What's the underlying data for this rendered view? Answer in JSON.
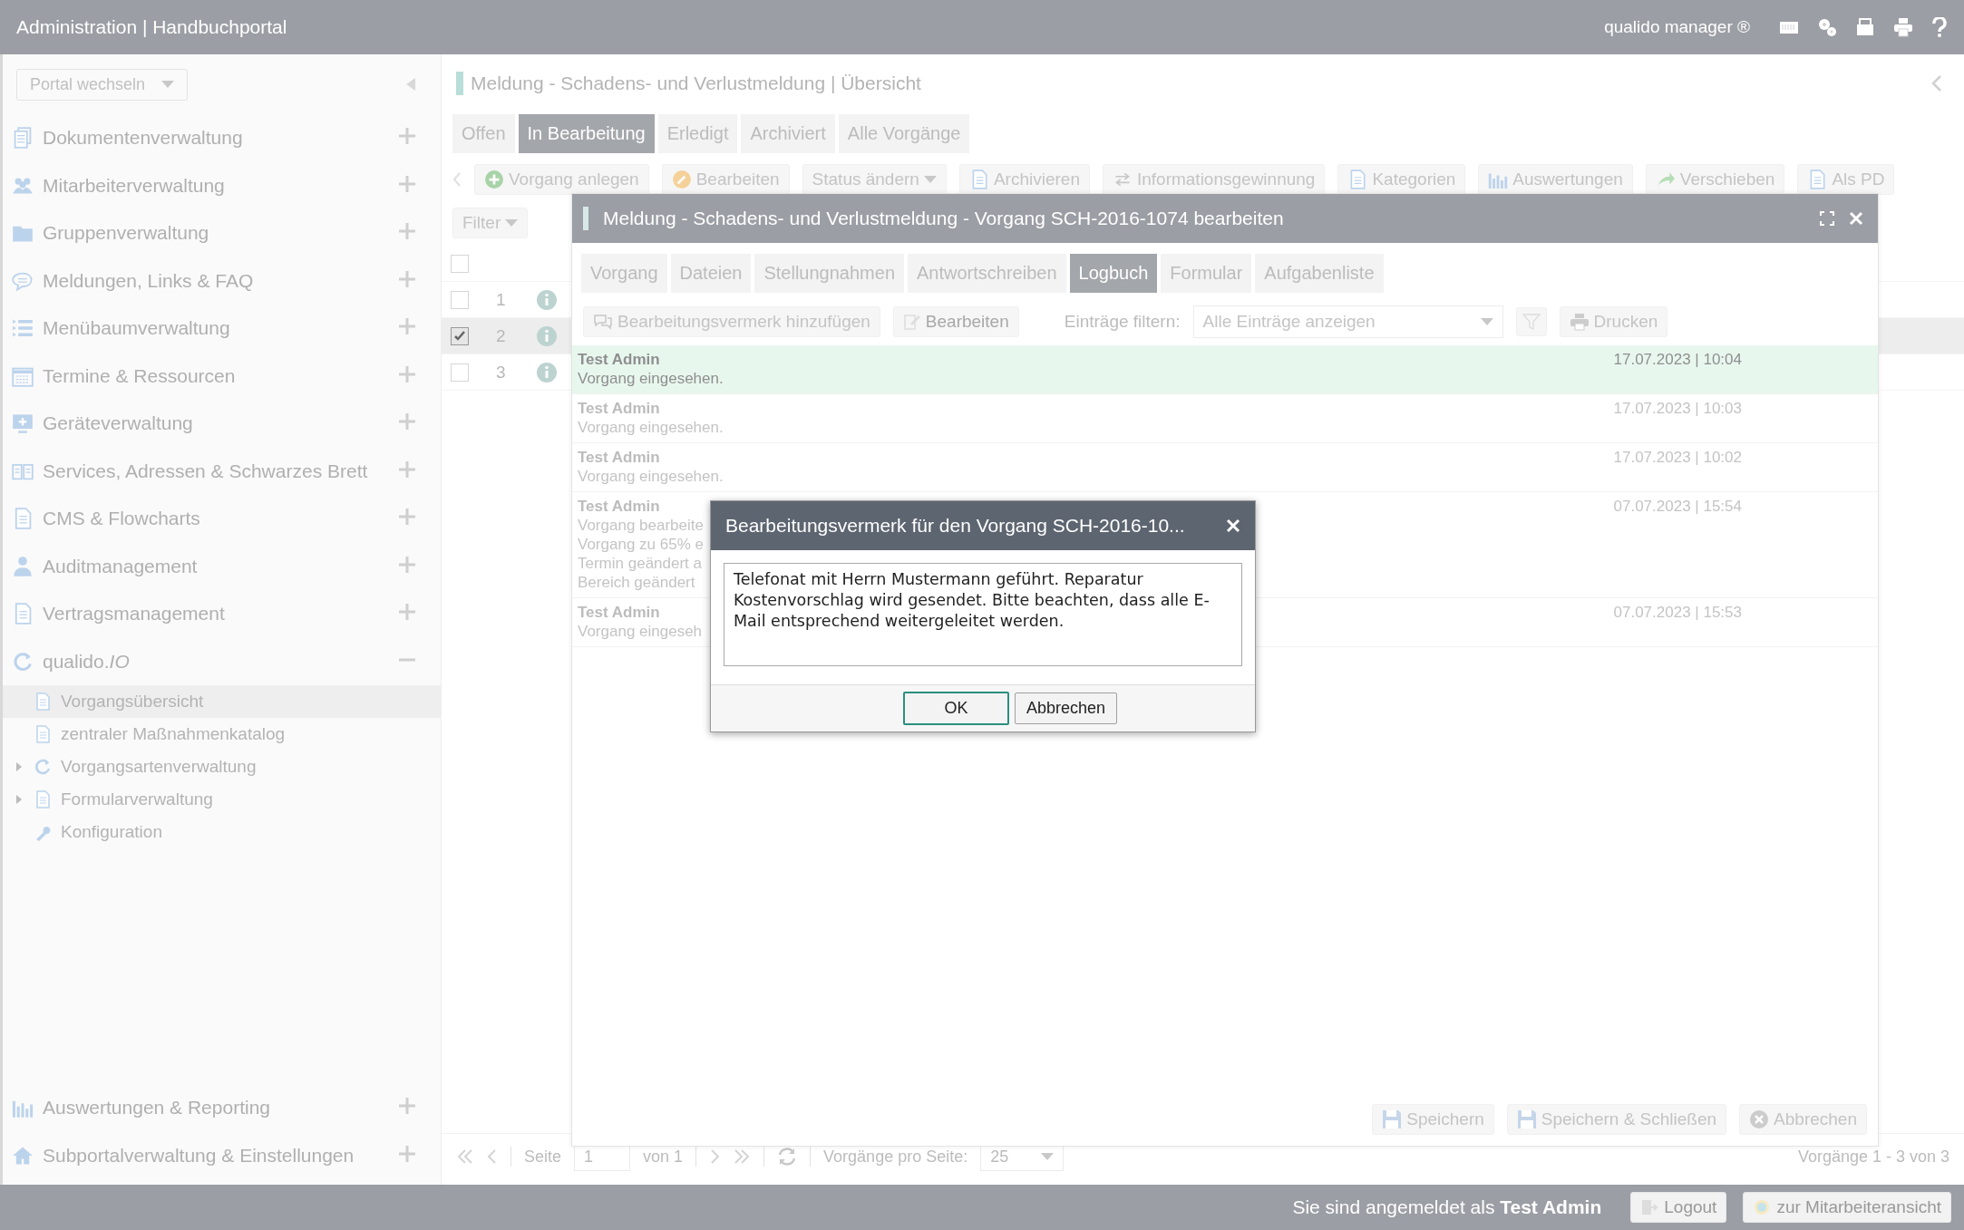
{
  "header": {
    "title": "Administration | Handbuchportal",
    "product": "qualido manager ®"
  },
  "sidebar": {
    "portal_select": "Portal wechseln",
    "items": [
      {
        "label": "Dokumentenverwaltung",
        "expanded": false
      },
      {
        "label": "Mitarbeiterverwaltung",
        "expanded": false
      },
      {
        "label": "Gruppenverwaltung",
        "expanded": false
      },
      {
        "label": "Meldungen, Links & FAQ",
        "expanded": false
      },
      {
        "label": "Menübaumverwaltung",
        "expanded": false
      },
      {
        "label": "Termine & Ressourcen",
        "expanded": false
      },
      {
        "label": "Geräteverwaltung",
        "expanded": false
      },
      {
        "label": "Services, Adressen & Schwarzes Brett",
        "expanded": false
      },
      {
        "label": "CMS & Flowcharts",
        "expanded": false
      },
      {
        "label": "Auditmanagement",
        "expanded": false
      },
      {
        "label": "Vertragsmanagement",
        "expanded": false
      },
      {
        "label": "qualido.*IO*",
        "expanded": true,
        "children": [
          {
            "label": "Vorgangsübersicht",
            "selected": true
          },
          {
            "label": "zentraler Maßnahmenkatalog",
            "selected": false
          },
          {
            "label": "Vorgangsartenverwaltung",
            "selected": false,
            "expanded": false
          },
          {
            "label": "Formularverwaltung",
            "selected": false,
            "expanded": false
          },
          {
            "label": "Konfiguration",
            "selected": false
          }
        ]
      }
    ],
    "bottom_items": [
      {
        "label": "Auswertungen & Reporting",
        "expanded": false
      },
      {
        "label": "Subportalverwaltung & Einstellungen",
        "expanded": false
      }
    ]
  },
  "main": {
    "title": "Meldung - Schadens- und Verlustmeldung | Übersicht",
    "tabs": [
      {
        "label": "Offen",
        "selected": false
      },
      {
        "label": "In Bearbeitung",
        "selected": true
      },
      {
        "label": "Erledigt",
        "selected": false
      },
      {
        "label": "Archiviert",
        "selected": false
      },
      {
        "label": "Alle Vorgänge",
        "selected": false
      }
    ],
    "toolbar": [
      {
        "label": "Vorgang anlegen",
        "kind": "button"
      },
      {
        "label": "Bearbeiten",
        "kind": "button"
      },
      {
        "label": "Status ändern",
        "kind": "dropdown"
      },
      {
        "label": "Archivieren",
        "kind": "button"
      },
      {
        "label": "Informationsgewinnung",
        "kind": "button"
      },
      {
        "label": "Kategorien",
        "kind": "button"
      },
      {
        "label": "Auswertungen",
        "kind": "button"
      },
      {
        "label": "Verschieben",
        "kind": "button"
      },
      {
        "label": "Als PD",
        "kind": "button"
      }
    ],
    "filter": "Filter",
    "header_checked": false,
    "rows": [
      {
        "number": "1",
        "checked": false,
        "selected": false
      },
      {
        "number": "2",
        "checked": true,
        "selected": true
      },
      {
        "number": "3",
        "checked": false,
        "selected": false
      }
    ],
    "pagination": {
      "page_label": "Seite",
      "page": "1",
      "of": "von 1",
      "per_page_label": "Vorgänge pro Seite:",
      "per_page": "25",
      "summary": "Vorgänge 1 - 3 von 3"
    }
  },
  "footer": {
    "login_text": "Sie sind angemeldet als **Test Admin**",
    "logout": "Logout",
    "employee_view": "zur Mitarbeiteransicht"
  },
  "edit_dialog": {
    "title": "Meldung - Schadens- und Verlustmeldung - Vorgang SCH-2016-1074 bearbeiten",
    "tabs": [
      {
        "label": "Vorgang",
        "selected": false
      },
      {
        "label": "Dateien",
        "selected": false
      },
      {
        "label": "Stellungnahmen",
        "selected": false
      },
      {
        "label": "Antwortschreiben",
        "selected": false
      },
      {
        "label": "Logbuch",
        "selected": true
      },
      {
        "label": "Formular",
        "selected": false
      },
      {
        "label": "Aufgabenliste",
        "selected": false
      }
    ],
    "add_note": "Bearbeitungsvermerk hinzufügen",
    "edit": "Bearbeiten",
    "filter_label": "Einträge filtern:",
    "filter_value": "Alle Einträge anzeigen",
    "print": "Drucken",
    "entries": [
      {
        "author": "Test Admin",
        "lines": [
          "Vorgang eingesehen."
        ],
        "time": "17.07.2023 | 10:04",
        "selected": true
      },
      {
        "author": "Test Admin",
        "lines": [
          "Vorgang eingesehen."
        ],
        "time": "17.07.2023 | 10:03",
        "selected": false
      },
      {
        "author": "Test Admin",
        "lines": [
          "Vorgang eingesehen."
        ],
        "time": "17.07.2023 | 10:02",
        "selected": false
      },
      {
        "author": "Test Admin",
        "lines": [
          "Vorgang bearbeite",
          "Vorgang zu 65% e",
          "Termin geändert a",
          "Bereich geändert"
        ],
        "time": "07.07.2023 | 15:54",
        "selected": false
      },
      {
        "author": "Test Admin",
        "lines": [
          "Vorgang eingeseh"
        ],
        "time": "07.07.2023 | 15:53",
        "selected": false
      }
    ],
    "buttons": [
      "Speichern",
      "Speichern & Schließen",
      "Abbrechen"
    ]
  },
  "note_dialog": {
    "title": "Bearbeitungsvermerk für den Vorgang SCH-2016-10...",
    "text": "Telefonat mit Herrn Mustermann geführt. Reparatur Kostenvorschlag wird gesendet. Bitte beachten, dass alle E-Mail entsprechend weitergeleitet werden.",
    "ok": "OK",
    "cancel": "Abbrechen"
  }
}
